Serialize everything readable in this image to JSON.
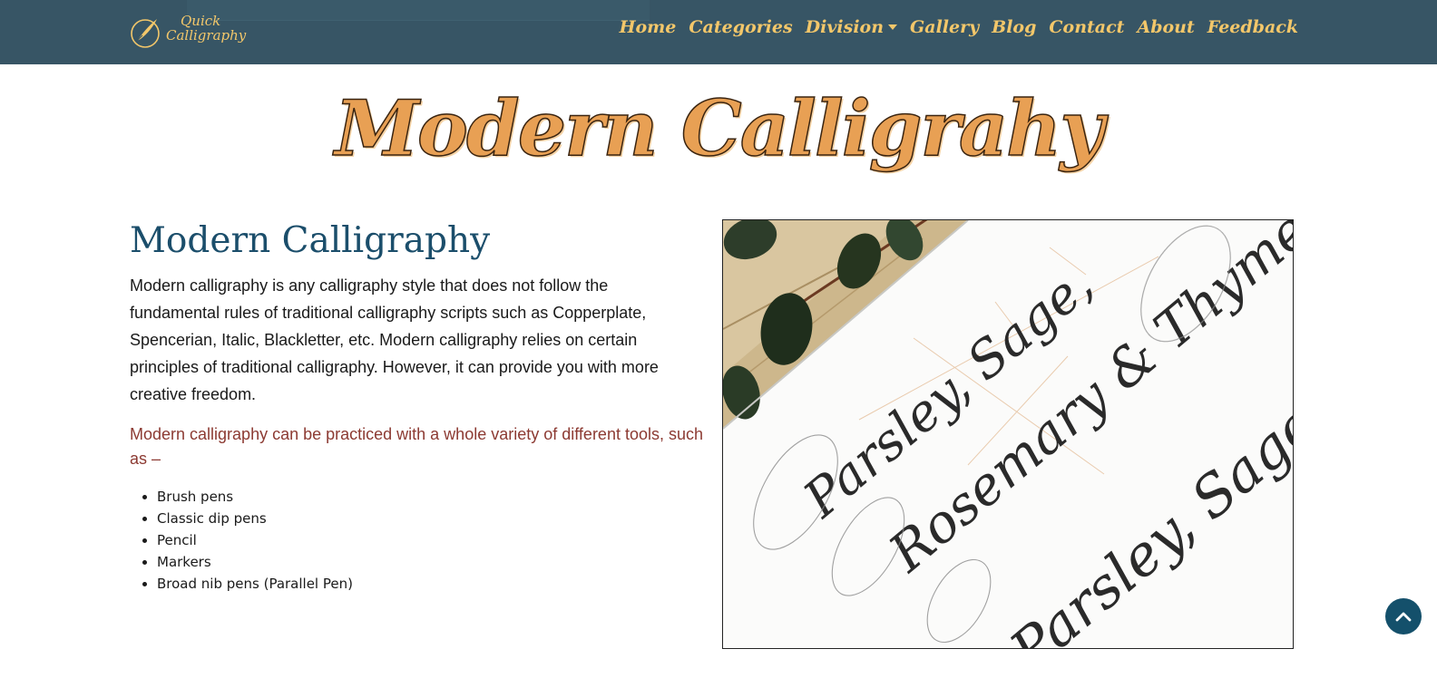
{
  "brand": {
    "line1": "Quick",
    "line2": "Calligraphy"
  },
  "nav": {
    "items": [
      "Home",
      "Categories",
      "Division",
      "Gallery",
      "Blog",
      "Contact",
      "About",
      "Feedback"
    ]
  },
  "hero": {
    "title": "Modern Calligrahy"
  },
  "section": {
    "heading": "Modern Calligraphy",
    "intro": "Modern calligraphy is any calligraphy style that does not follow the fundamental rules of traditional calligraphy scripts such as Copperplate, Spencerian, Italic, Blackletter, etc. Modern calligraphy relies on certain principles of traditional calligraphy. However, it can provide you with more creative freedom.",
    "tools_lead": "Modern calligraphy can be practiced with a whole variety of different tools, such as –",
    "tools": [
      "Brush pens",
      "Classic dip pens",
      "Pencil",
      "Markers",
      "Broad nib pens (Parallel Pen)"
    ]
  },
  "photo": {
    "script_lines": [
      "Parsley, Sage,",
      "Rosemary & Thyme",
      "Parsley, Sage,"
    ]
  },
  "colors": {
    "navbar": "#375565",
    "nav_text": "#f3c76a",
    "heading": "#1b4e6b",
    "accent_text": "#8c3a32",
    "hero_fill": "#e8a054",
    "back_to_top": "#14506b"
  },
  "icons": {
    "brand": "quill-pen-icon",
    "division_dropdown": "caret-down-icon",
    "back_to_top": "chevron-up-icon"
  }
}
